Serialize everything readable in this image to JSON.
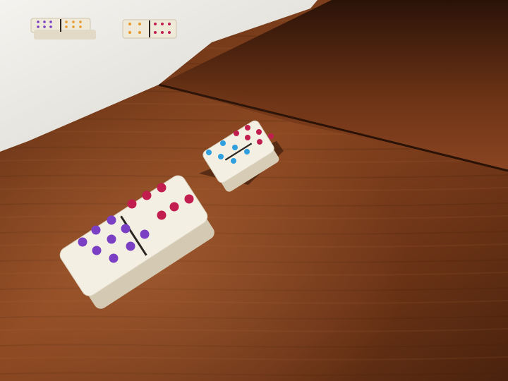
{
  "scene": {
    "description_free": true,
    "colors": {
      "table_dark": "#4a230f",
      "table_mid": "#7a3d1c",
      "table_light": "#a35a2e",
      "towel": "#ecebe6",
      "domino_body": "#f3eee2",
      "domino_edge": "#d9d0bd",
      "divider": "#2b2622",
      "pip_red": "#c21d4f",
      "pip_purple": "#7b3fc4",
      "pip_blue": "#2f9fe0",
      "pip_orange": "#e79a2a"
    },
    "dominoes": [
      {
        "name": "domino-front",
        "top_pips": 6,
        "bottom_pips": 9,
        "top_color": "pip_red",
        "bottom_color": "pip_purple"
      },
      {
        "name": "domino-middle",
        "top_pips": 6,
        "bottom_pips": 6,
        "top_color": "pip_red",
        "bottom_color": "pip_blue"
      },
      {
        "name": "domino-far-left",
        "top_pips": 6,
        "bottom_pips": 6,
        "top_color": "pip_purple",
        "bottom_color": "pip_orange"
      },
      {
        "name": "domino-far-right",
        "top_pips": 4,
        "bottom_pips": 6,
        "top_color": "pip_orange",
        "bottom_color": "pip_red"
      }
    ]
  }
}
